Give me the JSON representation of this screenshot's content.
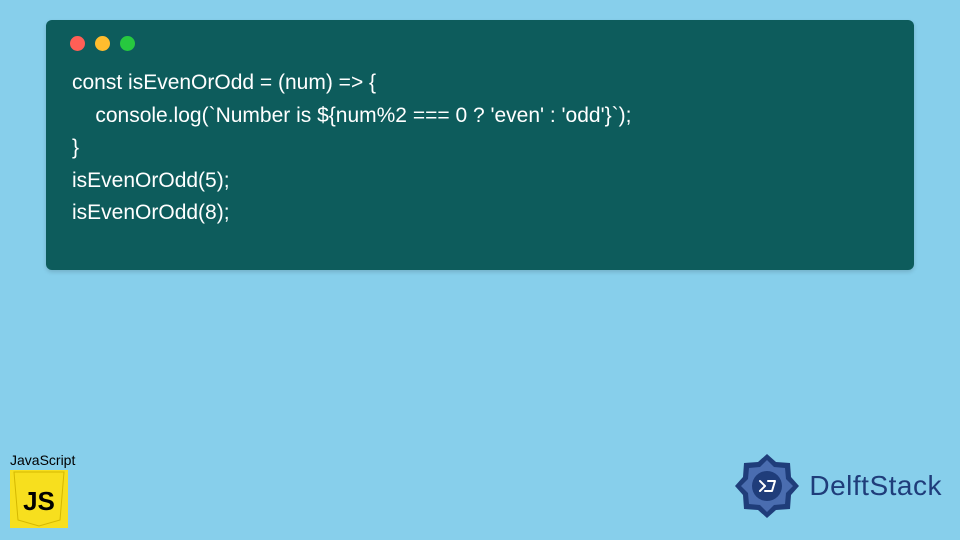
{
  "code_window": {
    "lines": [
      "const isEvenOrOdd = (num) => {",
      "    console.log(`Number is ${num%2 === 0 ? 'even' : 'odd'}`);",
      "}",
      "isEvenOrOdd(5);",
      "isEvenOrOdd(8);"
    ]
  },
  "js_badge": {
    "label": "JavaScript",
    "icon_text": "JS"
  },
  "delft": {
    "brand": "DelftStack"
  },
  "colors": {
    "page_bg": "#87cfeb",
    "window_bg": "#0d5c5c",
    "code_fg": "#ffffff",
    "js_yellow": "#f7df1e",
    "delft_blue": "#1f3d7a"
  }
}
